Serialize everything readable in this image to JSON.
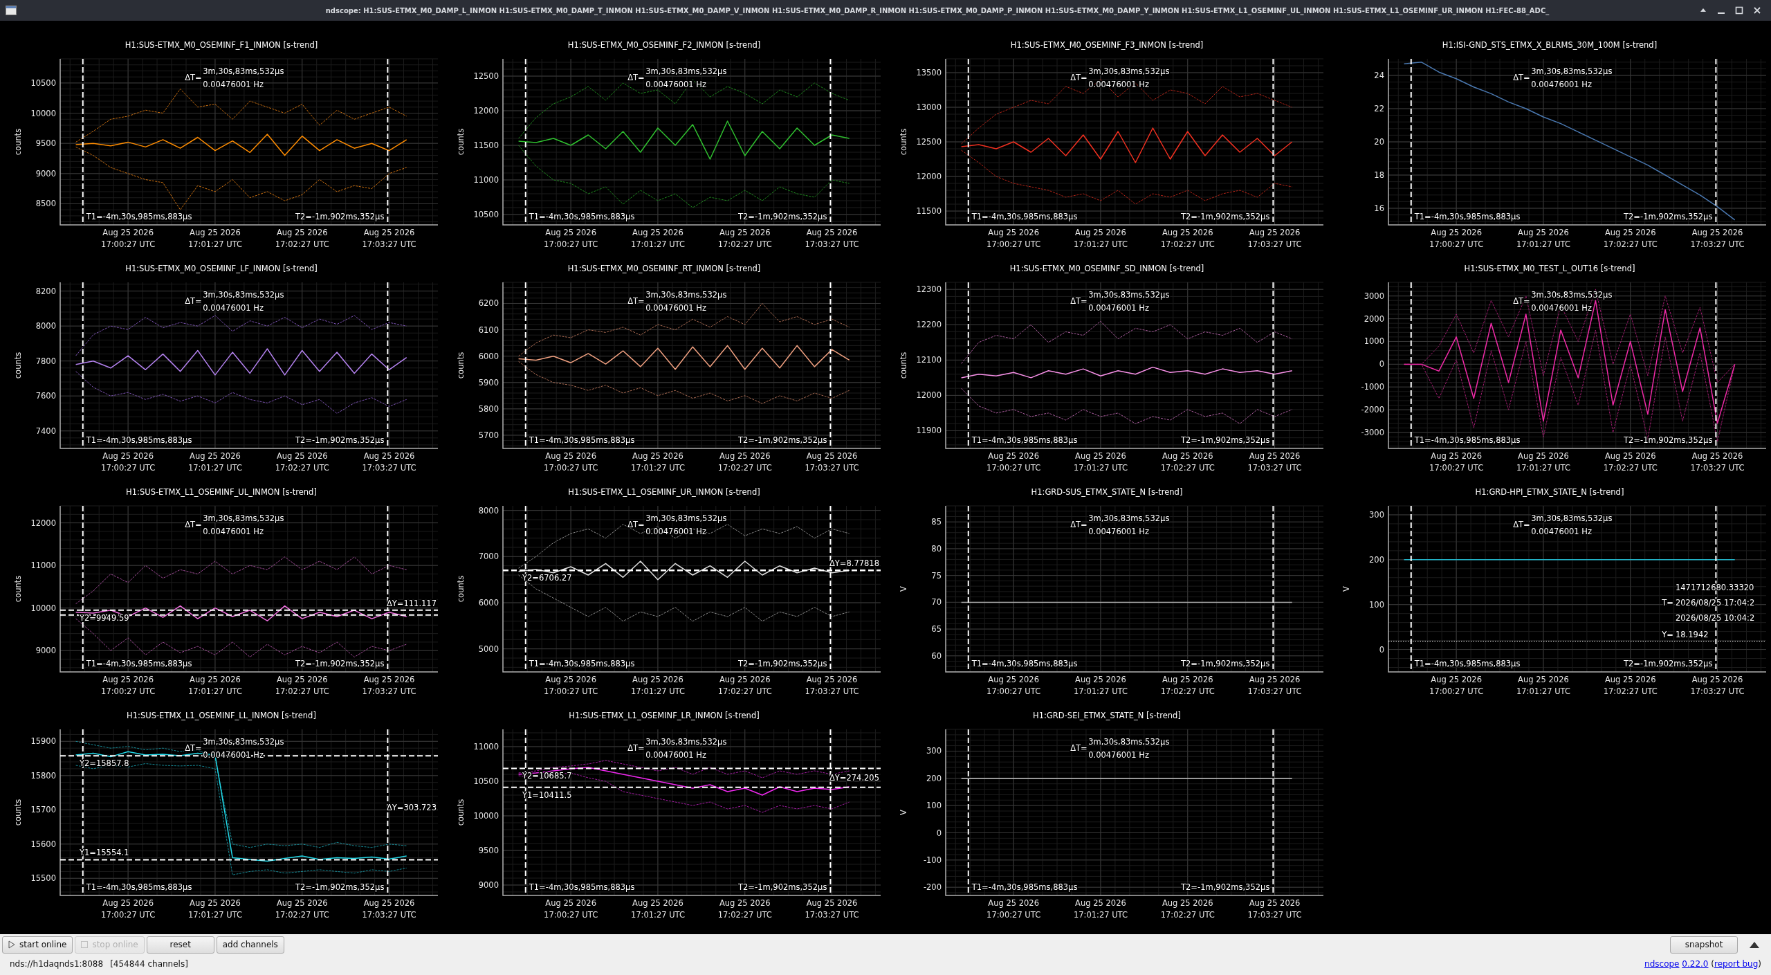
{
  "window": {
    "title": "ndscope: H1:SUS-ETMX_M0_DAMP_L_INMON H1:SUS-ETMX_M0_DAMP_T_INMON H1:SUS-ETMX_M0_DAMP_V_INMON H1:SUS-ETMX_M0_DAMP_R_INMON H1:SUS-ETMX_M0_DAMP_P_INMON H1:SUS-ETMX_M0_DAMP_Y_INMON H1:SUS-ETMX_L1_OSEMINF_UL_INMON H1:SUS-ETMX_L1_OSEMINF_UR_INMON H1:FEC-88_ADC_"
  },
  "plots": [
    {
      "chart_data": {
        "type": "line",
        "grid": true,
        "title": "H1:SUS-ETMX_M0_OSEMINF_F1_INMON [s-trend]",
        "ylabel": "counts",
        "ylim": [
          8150,
          10900
        ],
        "yticks": [
          8500,
          9000,
          9500,
          10000,
          10500
        ],
        "categories": [
          null,
          null,
          null,
          "Aug 25 2026\n17:00:27 UTC",
          null,
          null,
          null,
          null,
          "Aug 25 2026\n17:01:27 UTC",
          null,
          null,
          null,
          null,
          "Aug 25 2026\n17:02:27 UTC",
          null,
          null,
          null,
          null,
          "Aug 25 2026\n17:03:27 UTC",
          null
        ],
        "series": [
          {
            "color": "#ff8c00",
            "line_style": "solid",
            "values": [
              9480,
              9500,
              9460,
              9520,
              9440,
              9560,
              9420,
              9600,
              9380,
              9540,
              9350,
              9650,
              9300,
              9620,
              9380,
              9560,
              9420,
              9500,
              9380,
              9560
            ]
          },
          {
            "color": "#c86e10",
            "line_style": "dashed",
            "values": [
              9520,
              9700,
              9900,
              9950,
              10050,
              10000,
              10400,
              10100,
              10150,
              9900,
              10200,
              10100,
              10000,
              10150,
              9800,
              10050,
              9900,
              10000,
              10100,
              9950
            ]
          },
          {
            "color": "#c86e10",
            "line_style": "dashed",
            "values": [
              9440,
              9300,
              9100,
              9000,
              8900,
              8850,
              8400,
              8800,
              8700,
              8900,
              8600,
              8700,
              8550,
              8650,
              8900,
              8700,
              8800,
              8750,
              9000,
              9100
            ]
          }
        ]
      },
      "cursors": {
        "t1": "T1=-4m,30s,985ms,883µs",
        "t2": "T2=-1m,902ms,352µs",
        "delta_t": {
          "prefix": "ΔT=",
          "value": "3m,30s,83ms,532µs",
          "freq": "0.00476001 Hz"
        }
      }
    },
    {
      "chart_data": {
        "type": "line",
        "grid": true,
        "title": "H1:SUS-ETMX_M0_OSEMINF_F2_INMON [s-trend]",
        "ylabel": "counts",
        "ylim": [
          10350,
          12750
        ],
        "yticks": [
          10500,
          11000,
          11500,
          12000,
          12500
        ],
        "categories": [
          null,
          null,
          null,
          "Aug 25 2026\n17:00:27 UTC",
          null,
          null,
          null,
          null,
          "Aug 25 2026\n17:01:27 UTC",
          null,
          null,
          null,
          null,
          "Aug 25 2026\n17:02:27 UTC",
          null,
          null,
          null,
          null,
          "Aug 25 2026\n17:03:27 UTC",
          null
        ],
        "series": [
          {
            "color": "#2fbf2f",
            "line_style": "solid",
            "values": [
              11560,
              11540,
              11600,
              11500,
              11650,
              11450,
              11700,
              11400,
              11750,
              11500,
              11800,
              11300,
              11850,
              11350,
              11700,
              11450,
              11750,
              11500,
              11650,
              11600
            ]
          },
          {
            "color": "#1f8a1f",
            "line_style": "dashed",
            "values": [
              11600,
              11900,
              12100,
              12200,
              12350,
              12150,
              12400,
              12250,
              12300,
              12100,
              12450,
              12200,
              12350,
              12250,
              12100,
              12300,
              12200,
              12400,
              12250,
              12150
            ]
          },
          {
            "color": "#1f8a1f",
            "line_style": "dashed",
            "values": [
              11500,
              11200,
              11000,
              10950,
              10800,
              10900,
              10650,
              10850,
              10700,
              10800,
              10600,
              10750,
              10700,
              10850,
              10700,
              10900,
              10800,
              10750,
              11000,
              10950
            ]
          }
        ]
      },
      "cursors": {
        "t1": "T1=-4m,30s,985ms,883µs",
        "t2": "T2=-1m,902ms,352µs",
        "delta_t": {
          "prefix": "ΔT=",
          "value": "3m,30s,83ms,532µs",
          "freq": "0.00476001 Hz"
        }
      }
    },
    {
      "chart_data": {
        "type": "line",
        "grid": true,
        "title": "H1:SUS-ETMX_M0_OSEMINF_F3_INMON [s-trend]",
        "ylabel": "counts",
        "ylim": [
          11300,
          13700
        ],
        "yticks": [
          11500,
          12000,
          12500,
          13000,
          13500
        ],
        "categories": [
          null,
          null,
          null,
          "Aug 25 2026\n17:00:27 UTC",
          null,
          null,
          null,
          null,
          "Aug 25 2026\n17:01:27 UTC",
          null,
          null,
          null,
          null,
          "Aug 25 2026\n17:02:27 UTC",
          null,
          null,
          null,
          null,
          "Aug 25 2026\n17:03:27 UTC",
          null
        ],
        "series": [
          {
            "color": "#f03020",
            "line_style": "solid",
            "values": [
              12430,
              12460,
              12400,
              12500,
              12350,
              12550,
              12300,
              12600,
              12250,
              12650,
              12200,
              12700,
              12250,
              12650,
              12300,
              12600,
              12350,
              12550,
              12300,
              12500
            ]
          },
          {
            "color": "#b02418",
            "line_style": "dashed",
            "values": [
              12470,
              12700,
              12900,
              13000,
              13100,
              13050,
              13300,
              13200,
              13400,
              13150,
              13350,
              13100,
              13250,
              13200,
              13050,
              13300,
              13150,
              13200,
              13100,
              13000
            ]
          },
          {
            "color": "#b02418",
            "line_style": "dashed",
            "values": [
              12380,
              12200,
              12000,
              11900,
              11850,
              11800,
              11700,
              11750,
              11650,
              11800,
              11600,
              11750,
              11700,
              11800,
              11650,
              11750,
              11800,
              11700,
              11900,
              11850
            ]
          }
        ]
      },
      "cursors": {
        "t1": "T1=-4m,30s,985ms,883µs",
        "t2": "T2=-1m,902ms,352µs",
        "delta_t": {
          "prefix": "ΔT=",
          "value": "3m,30s,83ms,532µs",
          "freq": "0.00476001 Hz"
        }
      }
    },
    {
      "chart_data": {
        "type": "line",
        "grid": true,
        "title": "H1:ISI-GND_STS_ETMX_X_BLRMS_30M_100M [s-trend]",
        "ylim": [
          15,
          25
        ],
        "yticks": [
          16,
          18,
          20,
          22,
          24
        ],
        "categories": [
          null,
          null,
          null,
          "Aug 25 2026\n17:00:27 UTC",
          null,
          null,
          null,
          null,
          "Aug 25 2026\n17:01:27 UTC",
          null,
          null,
          null,
          null,
          "Aug 25 2026\n17:02:27 UTC",
          null,
          null,
          null,
          null,
          "Aug 25 2026\n17:03:27 UTC",
          null
        ],
        "series": [
          {
            "color": "#4a78b0",
            "line_style": "solid",
            "values": [
              24.7,
              24.8,
              24.2,
              23.8,
              23.3,
              22.9,
              22.4,
              22.0,
              21.5,
              21.1,
              20.6,
              20.1,
              19.6,
              19.1,
              18.6,
              18.0,
              17.4,
              16.8,
              16.1,
              15.3
            ]
          }
        ]
      },
      "cursors": {
        "t1": "T1=-4m,30s,985ms,883µs",
        "t2": "T2=-1m,902ms,352µs",
        "delta_t": {
          "prefix": "ΔT=",
          "value": "3m,30s,83ms,532µs",
          "freq": "0.00476001 Hz"
        }
      }
    },
    {
      "chart_data": {
        "type": "line",
        "grid": true,
        "title": "H1:SUS-ETMX_M0_OSEMINF_LF_INMON [s-trend]",
        "ylabel": "counts",
        "ylim": [
          7300,
          8250
        ],
        "yticks": [
          7400,
          7600,
          7800,
          8000,
          8200
        ],
        "categories": [
          null,
          null,
          null,
          "Aug 25 2026\n17:00:27 UTC",
          null,
          null,
          null,
          null,
          "Aug 25 2026\n17:01:27 UTC",
          null,
          null,
          null,
          null,
          "Aug 25 2026\n17:02:27 UTC",
          null,
          null,
          null,
          null,
          "Aug 25 2026\n17:03:27 UTC",
          null
        ],
        "series": [
          {
            "color": "#b482f0",
            "line_style": "solid",
            "values": [
              7780,
              7800,
              7760,
              7830,
              7750,
              7840,
              7740,
              7860,
              7720,
              7850,
              7730,
              7870,
              7720,
              7860,
              7740,
              7850,
              7730,
              7840,
              7750,
              7820
            ]
          },
          {
            "color": "#7a52b0",
            "line_style": "dashed",
            "values": [
              7830,
              7950,
              8000,
              7980,
              8050,
              7990,
              8020,
              8000,
              8060,
              7970,
              8030,
              8000,
              8050,
              7990,
              8040,
              8010,
              8060,
              7980,
              8020,
              8000
            ]
          },
          {
            "color": "#7a52b0",
            "line_style": "dashed",
            "values": [
              7740,
              7650,
              7600,
              7620,
              7580,
              7610,
              7570,
              7600,
              7560,
              7620,
              7580,
              7560,
              7600,
              7550,
              7580,
              7500,
              7560,
              7590,
              7540,
              7580
            ]
          }
        ]
      },
      "cursors": {
        "t1": "T1=-4m,30s,985ms,883µs",
        "t2": "T2=-1m,902ms,352µs",
        "delta_t": {
          "prefix": "ΔT=",
          "value": "3m,30s,83ms,532µs",
          "freq": "0.00476001 Hz"
        }
      }
    },
    {
      "chart_data": {
        "type": "line",
        "grid": true,
        "title": "H1:SUS-ETMX_M0_OSEMINF_RT_INMON [s-trend]",
        "ylabel": "counts",
        "ylim": [
          5650,
          6280
        ],
        "yticks": [
          5700,
          5800,
          5900,
          6000,
          6100,
          6200
        ],
        "categories": [
          null,
          null,
          null,
          "Aug 25 2026\n17:00:27 UTC",
          null,
          null,
          null,
          null,
          "Aug 25 2026\n17:01:27 UTC",
          null,
          null,
          null,
          null,
          "Aug 25 2026\n17:02:27 UTC",
          null,
          null,
          null,
          null,
          "Aug 25 2026\n17:03:27 UTC",
          null
        ],
        "series": [
          {
            "color": "#f0a080",
            "line_style": "solid",
            "values": [
              5990,
              5985,
              6000,
              5975,
              6010,
              5970,
              6020,
              5960,
              6030,
              5950,
              6035,
              5960,
              6040,
              5950,
              6030,
              5955,
              6040,
              5960,
              6025,
              5985
            ]
          },
          {
            "color": "#a86a52",
            "line_style": "dashed",
            "values": [
              6000,
              6050,
              6080,
              6070,
              6100,
              6090,
              6110,
              6080,
              6120,
              6100,
              6140,
              6110,
              6150,
              6120,
              6200,
              6130,
              6150,
              6120,
              6140,
              6110
            ]
          },
          {
            "color": "#a86a52",
            "line_style": "dashed",
            "values": [
              5980,
              5930,
              5900,
              5890,
              5870,
              5890,
              5860,
              5880,
              5850,
              5870,
              5840,
              5860,
              5830,
              5850,
              5820,
              5850,
              5830,
              5860,
              5840,
              5870
            ]
          }
        ]
      },
      "cursors": {
        "t1": "T1=-4m,30s,985ms,883µs",
        "t2": "T2=-1m,902ms,352µs",
        "delta_t": {
          "prefix": "ΔT=",
          "value": "3m,30s,83ms,532µs",
          "freq": "0.00476001 Hz"
        }
      }
    },
    {
      "chart_data": {
        "type": "line",
        "grid": true,
        "title": "H1:SUS-ETMX_M0_OSEMINF_SD_INMON [s-trend]",
        "ylabel": "counts",
        "ylim": [
          11850,
          12320
        ],
        "yticks": [
          11900,
          12000,
          12100,
          12200,
          12300
        ],
        "categories": [
          null,
          null,
          null,
          "Aug 25 2026\n17:00:27 UTC",
          null,
          null,
          null,
          null,
          "Aug 25 2026\n17:01:27 UTC",
          null,
          null,
          null,
          null,
          "Aug 25 2026\n17:02:27 UTC",
          null,
          null,
          null,
          null,
          "Aug 25 2026\n17:03:27 UTC",
          null
        ],
        "series": [
          {
            "color": "#f890e8",
            "line_style": "solid",
            "values": [
              12050,
              12060,
              12055,
              12065,
              12050,
              12070,
              12060,
              12075,
              12055,
              12070,
              12060,
              12080,
              12065,
              12070,
              12060,
              12075,
              12065,
              12070,
              12060,
              12070
            ]
          },
          {
            "color": "#a85c9c",
            "line_style": "dashed",
            "values": [
              12090,
              12150,
              12170,
              12160,
              12200,
              12150,
              12180,
              12170,
              12210,
              12160,
              12190,
              12180,
              12200,
              12160,
              12180,
              12170,
              12190,
              12150,
              12180,
              12160
            ]
          },
          {
            "color": "#a85c9c",
            "line_style": "dashed",
            "values": [
              12020,
              11970,
              11950,
              11960,
              11940,
              11950,
              11930,
              11960,
              11940,
              11950,
              11920,
              11940,
              11930,
              11960,
              11940,
              11950,
              11920,
              11960,
              11940,
              11960
            ]
          }
        ]
      },
      "cursors": {
        "t1": "T1=-4m,30s,985ms,883µs",
        "t2": "T2=-1m,902ms,352µs",
        "delta_t": {
          "prefix": "ΔT=",
          "value": "3m,30s,83ms,532µs",
          "freq": "0.00476001 Hz"
        }
      }
    },
    {
      "chart_data": {
        "type": "line",
        "grid": true,
        "title": "H1:SUS-ETMX_M0_TEST_L_OUT16 [s-trend]",
        "ylim": [
          -3700,
          3600
        ],
        "yticks": [
          -3000,
          -2000,
          -1000,
          0,
          1000,
          2000,
          3000
        ],
        "categories": [
          null,
          null,
          null,
          "Aug 25 2026\n17:00:27 UTC",
          null,
          null,
          null,
          null,
          "Aug 25 2026\n17:01:27 UTC",
          null,
          null,
          null,
          null,
          "Aug 25 2026\n17:02:27 UTC",
          null,
          null,
          null,
          null,
          "Aug 25 2026\n17:03:27 UTC",
          null
        ],
        "series": [
          {
            "color": "#f02aa8",
            "line_style": "solid",
            "values": [
              0,
              0,
              -300,
              1200,
              -1500,
              1800,
              -800,
              2200,
              -2500,
              1500,
              -600,
              2800,
              -1800,
              1000,
              -2200,
              2400,
              -1200,
              1600,
              -2600,
              0
            ]
          },
          {
            "color": "#a01c70",
            "line_style": "dashed",
            "values": [
              0,
              0,
              800,
              2200,
              500,
              2800,
              1200,
              3000,
              -500,
              2600,
              1000,
              3300,
              0,
              2200,
              -500,
              3000,
              500,
              2500,
              -800,
              0
            ]
          },
          {
            "color": "#a01c70",
            "line_style": "dashed",
            "values": [
              0,
              0,
              -1500,
              200,
              -2800,
              600,
              -2000,
              1000,
              -3200,
              300,
              -1800,
              1500,
              -3000,
              0,
              -3300,
              1200,
              -2500,
              500,
              -3400,
              0
            ]
          }
        ]
      },
      "cursors": {
        "t1": "T1=-4m,30s,985ms,883µs",
        "t2": "T2=-1m,902ms,352µs",
        "delta_t": {
          "prefix": "ΔT=",
          "value": "3m,30s,83ms,532µs",
          "freq": "0.00476001 Hz"
        }
      }
    },
    {
      "chart_data": {
        "type": "line",
        "grid": true,
        "title": "H1:SUS-ETMX_L1_OSEMINF_UL_INMON [s-trend]",
        "ylabel": "counts",
        "ylim": [
          8500,
          12400
        ],
        "yticks": [
          9000,
          10000,
          11000,
          12000
        ],
        "categories": [
          null,
          null,
          null,
          "Aug 25 2026\n17:00:27 UTC",
          null,
          null,
          null,
          null,
          "Aug 25 2026\n17:01:27 UTC",
          null,
          null,
          null,
          null,
          "Aug 25 2026\n17:02:27 UTC",
          null,
          null,
          null,
          null,
          "Aug 25 2026\n17:03:27 UTC",
          null
        ],
        "series": [
          {
            "color": "#f070e0",
            "line_style": "solid",
            "values": [
              9900,
              9880,
              9950,
              9800,
              10000,
              9780,
              10050,
              9750,
              10000,
              9800,
              9950,
              9700,
              10050,
              9750,
              9900,
              9800,
              9950,
              9750,
              9900,
              9800
            ]
          },
          {
            "color": "#a04c98",
            "line_style": "dashed",
            "values": [
              10100,
              10400,
              10800,
              10600,
              11000,
              10700,
              10900,
              10800,
              11100,
              10800,
              11000,
              10900,
              11200,
              10900,
              11100,
              10900,
              11200,
              10800,
              11000,
              10900
            ]
          },
          {
            "color": "#a04c98",
            "line_style": "dashed",
            "values": [
              9750,
              9400,
              9000,
              9300,
              8900,
              9200,
              8950,
              9100,
              8900,
              9200,
              8850,
              9150,
              8900,
              9100,
              8950,
              9200,
              8850,
              9100,
              9000,
              9150
            ]
          }
        ]
      },
      "cursors": {
        "t1": "T1=-4m,30s,985ms,883µs",
        "t2": "T2=-1m,902ms,352µs",
        "y2": "Y2=9949.59",
        "delta_y": "ΔY=111.117",
        "delta_t": {
          "prefix": "ΔT=",
          "value": "3m,30s,83ms,532µs",
          "freq": "0.00476001 Hz"
        }
      }
    },
    {
      "chart_data": {
        "type": "line",
        "grid": true,
        "title": "H1:SUS-ETMX_L1_OSEMINF_UR_INMON [s-trend]",
        "ylabel": "counts",
        "ylim": [
          4500,
          8100
        ],
        "yticks": [
          5000,
          6000,
          7000,
          8000
        ],
        "categories": [
          null,
          null,
          null,
          "Aug 25 2026\n17:00:27 UTC",
          null,
          null,
          null,
          null,
          "Aug 25 2026\n17:01:27 UTC",
          null,
          null,
          null,
          null,
          "Aug 25 2026\n17:02:27 UTC",
          null,
          null,
          null,
          null,
          "Aug 25 2026\n17:03:27 UTC",
          null
        ],
        "series": [
          {
            "color": "#e0e0e0",
            "line_style": "solid",
            "values": [
              6680,
              6720,
              6650,
              6780,
              6600,
              6850,
              6550,
              6900,
              6500,
              6850,
              6600,
              6800,
              6550,
              6900,
              6600,
              6800,
              6650,
              6750,
              6650,
              6700
            ]
          },
          {
            "color": "#8a8a8a",
            "line_style": "dashed",
            "values": [
              6750,
              7000,
              7300,
              7500,
              7600,
              7400,
              7700,
              7500,
              7650,
              7400,
              7600,
              7500,
              7700,
              7450,
              7600,
              7500,
              7650,
              7400,
              7600,
              7500
            ]
          },
          {
            "color": "#8a8a8a",
            "line_style": "dashed",
            "values": [
              6600,
              6300,
              6100,
              5900,
              5700,
              5900,
              5600,
              5800,
              5700,
              5900,
              5600,
              5800,
              5700,
              5900,
              5600,
              5800,
              5700,
              5900,
              5700,
              5800
            ]
          }
        ]
      },
      "cursors": {
        "t1": "T1=-4m,30s,985ms,883µs",
        "t2": "T2=-1m,902ms,352µs",
        "y2": "Y2=6706.27",
        "delta_y": "ΔY=8.77818",
        "delta_t": {
          "prefix": "ΔT=",
          "value": "3m,30s,83ms,532µs",
          "freq": "0.00476001 Hz"
        }
      }
    },
    {
      "chart_data": {
        "type": "line",
        "grid": true,
        "title": "H1:GRD-SUS_ETMX_STATE_N [s-trend]",
        "ylabel": "V",
        "ylim": [
          57,
          88
        ],
        "yticks": [
          60,
          65,
          70,
          75,
          80,
          85
        ],
        "categories": [
          null,
          null,
          null,
          "Aug 25 2026\n17:00:27 UTC",
          null,
          null,
          null,
          null,
          "Aug 25 2026\n17:01:27 UTC",
          null,
          null,
          null,
          null,
          "Aug 25 2026\n17:02:27 UTC",
          null,
          null,
          null,
          null,
          "Aug 25 2026\n17:03:27 UTC",
          null
        ],
        "series": [
          {
            "color": "#a8a8a8",
            "line_style": "solid",
            "values": [
              70,
              70,
              70,
              70,
              70,
              70,
              70,
              70,
              70,
              70,
              70,
              70,
              70,
              70,
              70,
              70,
              70,
              70,
              70,
              70
            ]
          }
        ]
      },
      "cursors": {
        "t1": "T1=-4m,30s,985ms,883µs",
        "t2": "T2=-1m,902ms,352µs",
        "delta_t": {
          "prefix": "ΔT=",
          "value": "3m,30s,83ms,532µs",
          "freq": "0.00476001 Hz"
        }
      }
    },
    {
      "chart_data": {
        "type": "line",
        "grid": true,
        "title": "H1:GRD-HPI_ETMX_STATE_N [s-trend]",
        "ylabel": "V",
        "ylim": [
          -50,
          320
        ],
        "yticks": [
          0,
          100,
          200,
          300
        ],
        "categories": [
          null,
          null,
          null,
          "Aug 25 2026\n17:00:27 UTC",
          null,
          null,
          null,
          null,
          "Aug 25 2026\n17:01:27 UTC",
          null,
          null,
          null,
          null,
          "Aug 25 2026\n17:02:27 UTC",
          null,
          null,
          null,
          null,
          "Aug 25 2026\n17:03:27 UTC",
          null
        ],
        "series": [
          {
            "color": "#22b4c8",
            "line_style": "solid",
            "values": [
              200,
              200,
              200,
              200,
              200,
              200,
              200,
              200,
              200,
              200,
              200,
              200,
              200,
              200,
              200,
              200,
              200,
              200,
              200,
              200
            ]
          }
        ],
        "ref_lines": [
          {
            "axis": "y",
            "value": 18.1942
          }
        ]
      },
      "cursors": {
        "t1": "T1=-4m,30s,985ms,883µs",
        "t2": "T2=-1m,902ms,352µs",
        "delta_t": {
          "prefix": "ΔT=",
          "value": "3m,30s,83ms,532µs",
          "freq": "0.00476001 Hz"
        },
        "crosshair": {
          "gps": "1471712680.33320",
          "t_label": "T=",
          "utc": "2026/08/25 17:04:2",
          "local": "2026/08/25 10:04:2",
          "y_label": "Y=",
          "y_value": "18.1942"
        }
      }
    },
    {
      "chart_data": {
        "type": "line",
        "grid": true,
        "title": "H1:SUS-ETMX_L1_OSEMINF_LL_INMON [s-trend]",
        "ylabel": "counts",
        "ylim": [
          15450,
          15935
        ],
        "yticks": [
          15500,
          15600,
          15700,
          15800,
          15900
        ],
        "categories": [
          null,
          null,
          null,
          "Aug 25 2026\n17:00:27 UTC",
          null,
          null,
          null,
          null,
          "Aug 25 2026\n17:01:27 UTC",
          null,
          null,
          null,
          null,
          "Aug 25 2026\n17:02:27 UTC",
          null,
          null,
          null,
          null,
          "Aug 25 2026\n17:03:27 UTC",
          null
        ],
        "series": [
          {
            "color": "#22d8e8",
            "line_style": "solid",
            "values": [
              15860,
              15865,
              15855,
              15870,
              15860,
              15862,
              15858,
              15865,
              15860,
              15560,
              15555,
              15550,
              15558,
              15565,
              15555,
              15560,
              15558,
              15562,
              15556,
              15565
            ]
          },
          {
            "color": "#168a96",
            "line_style": "dashed",
            "values": [
              15900,
              15890,
              15880,
              15885,
              15875,
              15880,
              15870,
              15875,
              15850,
              15600,
              15590,
              15600,
              15595,
              15600,
              15590,
              15605,
              15595,
              15590,
              15600,
              15595
            ]
          },
          {
            "color": "#168a96",
            "line_style": "dashed",
            "values": [
              15830,
              15820,
              15830,
              15825,
              15835,
              15830,
              15828,
              15830,
              15820,
              15510,
              15520,
              15525,
              15515,
              15520,
              15525,
              15520,
              15515,
              15525,
              15520,
              15530
            ]
          }
        ]
      },
      "cursors": {
        "t1": "T1=-4m,30s,985ms,883µs",
        "t2": "T2=-1m,902ms,352µs",
        "y2": "Y2=15857.8",
        "y1": "Y1=15554.1",
        "delta_y": "ΔY=303.723",
        "delta_t": {
          "prefix": "ΔT=",
          "value": "3m,30s,83ms,532µs",
          "freq": "0.00476001 Hz"
        }
      }
    },
    {
      "chart_data": {
        "type": "line",
        "grid": true,
        "title": "H1:SUS-ETMX_L1_OSEMINF_LR_INMON [s-trend]",
        "ylabel": "counts",
        "ylim": [
          8850,
          11250
        ],
        "yticks": [
          9000,
          9500,
          10000,
          10500,
          11000
        ],
        "categories": [
          null,
          null,
          null,
          "Aug 25 2026\n17:00:27 UTC",
          null,
          null,
          null,
          null,
          "Aug 25 2026\n17:01:27 UTC",
          null,
          null,
          null,
          null,
          "Aug 25 2026\n17:02:27 UTC",
          null,
          null,
          null,
          null,
          "Aug 25 2026\n17:03:27 UTC",
          null
        ],
        "series": [
          {
            "color": "#f028f0",
            "line_style": "solid",
            "values": [
              10600,
              10620,
              10650,
              10680,
              10700,
              10650,
              10600,
              10550,
              10500,
              10450,
              10400,
              10450,
              10350,
              10400,
              10300,
              10420,
              10350,
              10400,
              10380,
              10420
            ]
          },
          {
            "color": "#a01ca0",
            "line_style": "dashed",
            "values": [
              10620,
              10650,
              10700,
              10720,
              10750,
              10800,
              10750,
              10700,
              10650,
              10700,
              10600,
              10700,
              10600,
              10650,
              10550,
              10650,
              10600,
              10650,
              10600,
              10650
            ]
          },
          {
            "color": "#a01ca0",
            "line_style": "dashed",
            "values": [
              10580,
              10550,
              10600,
              10620,
              10550,
              10500,
              10350,
              10300,
              10250,
              10200,
              10150,
              10200,
              10100,
              10150,
              10050,
              10150,
              10100,
              10150,
              10100,
              10200
            ]
          }
        ]
      },
      "cursors": {
        "t1": "T1=-4m,30s,985ms,883µs",
        "t2": "T2=-1m,902ms,352µs",
        "y2": "Y2=10685.7",
        "y1": "Y1=10411.5",
        "delta_y": "ΔY=274.205",
        "delta_t": {
          "prefix": "ΔT=",
          "value": "3m,30s,83ms,532µs",
          "freq": "0.00476001 Hz"
        }
      }
    },
    {
      "chart_data": {
        "type": "line",
        "grid": true,
        "title": "H1:GRD-SEI_ETMX_STATE_N [s-trend]",
        "ylabel": "V",
        "ylim": [
          -230,
          380
        ],
        "yticks": [
          -200,
          -100,
          0,
          100,
          200,
          300
        ],
        "categories": [
          null,
          null,
          null,
          "Aug 25 2026\n17:00:27 UTC",
          null,
          null,
          null,
          null,
          "Aug 25 2026\n17:01:27 UTC",
          null,
          null,
          null,
          null,
          "Aug 25 2026\n17:02:27 UTC",
          null,
          null,
          null,
          null,
          "Aug 25 2026\n17:03:27 UTC",
          null
        ],
        "series": [
          {
            "color": "#c8c8c8",
            "line_style": "solid",
            "values": [
              200,
              200,
              200,
              200,
              200,
              200,
              200,
              200,
              200,
              200,
              200,
              200,
              200,
              200,
              200,
              200,
              200,
              200,
              200,
              200
            ]
          }
        ]
      },
      "cursors": {
        "t1": "T1=-4m,30s,985ms,883µs",
        "t2": "T2=-1m,902ms,352µs",
        "delta_t": {
          "prefix": "ΔT=",
          "value": "3m,30s,83ms,532µs",
          "freq": "0.00476001 Hz"
        }
      }
    }
  ],
  "toolbar": {
    "buttons": [
      {
        "label": "start online",
        "disabled": false
      },
      {
        "label": "stop online",
        "disabled": true
      },
      {
        "label": "reset",
        "disabled": false
      },
      {
        "label": "add channels",
        "disabled": false
      }
    ],
    "snapshot": "snapshot"
  },
  "status_bar": {
    "server": "nds://h1daqnds1:8088",
    "channels": "[454844 channels]",
    "about": [
      {
        "kind": "link",
        "text": "ndscope"
      },
      {
        "kind": "link",
        "text": "0.22.0"
      },
      {
        "kind": "open",
        "text": "("
      },
      {
        "kind": "link",
        "text": "report bug"
      },
      {
        "kind": "close",
        "text": ")"
      }
    ]
  }
}
